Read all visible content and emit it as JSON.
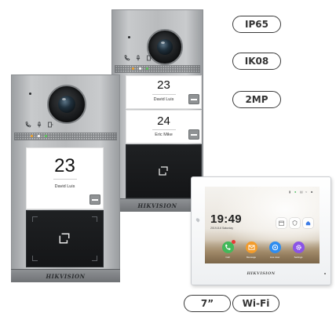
{
  "back_panel": {
    "units": [
      {
        "room": "23",
        "resident": "David Luis"
      },
      {
        "room": "24",
        "resident": "Eric Mike"
      }
    ],
    "brand": "HIKVISION"
  },
  "front_panel": {
    "room": "23",
    "resident": "David Luis",
    "brand": "HIKVISION"
  },
  "spec_badges": {
    "top": [
      "IP65",
      "IK08",
      "2MP"
    ],
    "bottom": [
      "7”",
      "Wi-Fi"
    ]
  },
  "monitor": {
    "time": "19:49",
    "date": "2019-8-6  Saturday",
    "apps": [
      {
        "label": "Call",
        "color": "#43b85a",
        "icon": "phone-icon"
      },
      {
        "label": "Message",
        "color": "#f39c2b",
        "icon": "envelope-icon"
      },
      {
        "label": "Live view",
        "color": "#2f8df0",
        "icon": "camera-icon"
      },
      {
        "label": "Settings",
        "color": "#8b54e6",
        "icon": "gear-icon"
      }
    ],
    "brand": "HIKVISION"
  }
}
